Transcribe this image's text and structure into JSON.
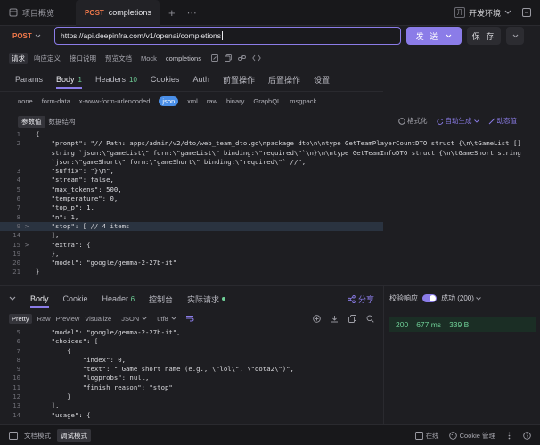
{
  "tabs": {
    "overview": "项目概览",
    "active_method": "POST",
    "active_name": "completions",
    "add": "+",
    "more": "⋯"
  },
  "env": {
    "icon_label": "开",
    "label": "开发环境"
  },
  "request": {
    "method": "POST",
    "url": "https://api.deepinfra.com/v1/openai/completions",
    "send_label": "发 送",
    "save_label": "保 存"
  },
  "subtabs": [
    "请求",
    "响应定义",
    "接口说明",
    "预览文档",
    "Mock"
  ],
  "subtab_name": "completions",
  "req_tabs": [
    {
      "label": "Params",
      "badge": ""
    },
    {
      "label": "Body",
      "badge": "1"
    },
    {
      "label": "Headers",
      "badge": "10"
    },
    {
      "label": "Cookies",
      "badge": ""
    },
    {
      "label": "Auth",
      "badge": ""
    },
    {
      "label": "前置操作",
      "badge": ""
    },
    {
      "label": "后置操作",
      "badge": ""
    },
    {
      "label": "设置",
      "badge": ""
    }
  ],
  "body_types": [
    "none",
    "form-data",
    "x-www-form-urlencoded",
    "json",
    "xml",
    "raw",
    "binary",
    "GraphQL",
    "msgpack"
  ],
  "param_tabs": [
    "参数值",
    "数据结构"
  ],
  "param_actions": {
    "format": "格式化",
    "autogen": "自动生成",
    "dynamic": "动态值"
  },
  "request_body": [
    {
      "ln": "1",
      "fold": "",
      "text": "{"
    },
    {
      "ln": "2",
      "fold": "",
      "text": "    \"prompt\": \"// Path: apps/admin/v2/dto/web_team_dto.go\\npackage dto\\n\\ntype GetTeamPlayerCountDTO struct {\\n\\tGameList []"
    },
    {
      "ln": "",
      "fold": "",
      "text": "    string `json:\\\"gameList\\\" form:\\\"gameList\\\" binding:\\\"required\\\"`\\n}\\n\\ntype GetTeamInfoDTO struct {\\n\\tGameShort string"
    },
    {
      "ln": "",
      "fold": "",
      "text": "    `json:\\\"gameShort\\\" form:\\\"gameShort\\\" binding:\\\"required\\\"` //\","
    },
    {
      "ln": "3",
      "fold": "",
      "text": "    \"suffix\": \"}\\n\","
    },
    {
      "ln": "4",
      "fold": "",
      "text": "    \"stream\": false,"
    },
    {
      "ln": "5",
      "fold": "",
      "text": "    \"max_tokens\": 500,"
    },
    {
      "ln": "6",
      "fold": "",
      "text": "    \"temperature\": 0,"
    },
    {
      "ln": "7",
      "fold": "",
      "text": "    \"top_p\": 1,"
    },
    {
      "ln": "8",
      "fold": "",
      "text": "    \"n\": 1,"
    },
    {
      "ln": "9",
      "fold": ">",
      "text": "    \"stop\": [ // 4 items ",
      "hl": true
    },
    {
      "ln": "14",
      "fold": "",
      "text": "    ],"
    },
    {
      "ln": "15",
      "fold": ">",
      "text": "    \"extra\": {"
    },
    {
      "ln": "19",
      "fold": "",
      "text": "    },"
    },
    {
      "ln": "20",
      "fold": "",
      "text": "    \"model\": \"google/gemma-2-27b-it\""
    },
    {
      "ln": "21",
      "fold": "",
      "text": "}"
    }
  ],
  "res_tabs": [
    {
      "label": "Body",
      "badge": ""
    },
    {
      "label": "Cookie",
      "badge": ""
    },
    {
      "label": "Header",
      "badge": "6"
    },
    {
      "label": "控制台",
      "badge": ""
    },
    {
      "label": "实际请求",
      "badge": ""
    }
  ],
  "share_label": "分享",
  "res_formats": [
    "Pretty",
    "Raw",
    "Preview",
    "Visualize"
  ],
  "res_select": {
    "format": "JSON",
    "encoding": "utf8"
  },
  "response_body": [
    {
      "ln": "5",
      "text": "    \"model\": \"google/gemma-2-27b-it\","
    },
    {
      "ln": "6",
      "text": "    \"choices\": ["
    },
    {
      "ln": "7",
      "text": "        {"
    },
    {
      "ln": "8",
      "text": "            \"index\": 0,"
    },
    {
      "ln": "9",
      "text": "            \"text\": \" Game short name (e.g., \\\"lol\\\", \\\"dota2\\\")\","
    },
    {
      "ln": "10",
      "text": "            \"logprobs\": null,"
    },
    {
      "ln": "11",
      "text": "            \"finish_reason\": \"stop\""
    },
    {
      "ln": "12",
      "text": "        }"
    },
    {
      "ln": "13",
      "text": "    ],"
    },
    {
      "ln": "14",
      "text": "    \"usage\": {"
    }
  ],
  "validate": {
    "label": "校验响应",
    "status": "成功 (200)"
  },
  "metrics": {
    "code": "200",
    "time": "677 ms",
    "size": "339 B"
  },
  "footer": {
    "doc_mode": "文档模式",
    "debug_mode": "调试模式",
    "online": "在线",
    "cookie": "Cookie 管理"
  },
  "colors": {
    "accent": "#8b7ce8",
    "method": "#f0784a",
    "success": "#6fcf97"
  }
}
